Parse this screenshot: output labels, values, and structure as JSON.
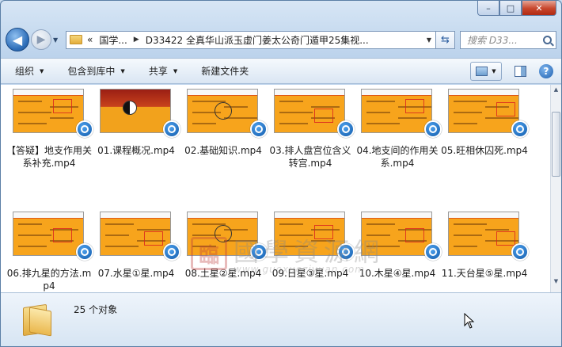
{
  "window": {
    "buttons": {
      "minimize": "–",
      "maximize": "□",
      "close": "✕"
    }
  },
  "nav": {
    "back_icon": "back-arrow-icon",
    "forward_icon": "forward-arrow-icon",
    "breadcrumb_overflow": "«",
    "breadcrumb": [
      "国学...",
      "D33422 全真华山派玉虚门姜太公奇门遁甲25集视..."
    ],
    "search_placeholder": "搜索 D33..."
  },
  "toolbar": {
    "organize": "组织",
    "include_in_library": "包含到库中",
    "share": "共享",
    "new_folder": "新建文件夹",
    "help": "?"
  },
  "files": [
    {
      "name": "【答疑】地支作用关系补充.mp4",
      "thumb": "notes"
    },
    {
      "name": "01.课程概况.mp4",
      "thumb": "course"
    },
    {
      "name": "02.基础知识.mp4",
      "thumb": "diagram"
    },
    {
      "name": "03.排人盘宫位含义转宫.mp4",
      "thumb": "notes"
    },
    {
      "name": "04.地支间的作用关系.mp4",
      "thumb": "notes"
    },
    {
      "name": "05.旺相休囚死.mp4",
      "thumb": "notes"
    },
    {
      "name": "06.排九星的方法.mp4",
      "thumb": "notes"
    },
    {
      "name": "07.水星①星.mp4",
      "thumb": "notes"
    },
    {
      "name": "08.土星②星.mp4",
      "thumb": "diagram"
    },
    {
      "name": "09.日星③星.mp4",
      "thumb": "notes"
    },
    {
      "name": "10.木星④星.mp4",
      "thumb": "notes"
    },
    {
      "name": "11.天台星⑤星.mp4",
      "thumb": "notes"
    }
  ],
  "watermark": {
    "seal": "臨",
    "text": "國學資源網",
    "url": "www.guoxueziyuan.com"
  },
  "details": {
    "item_count": "25 个对象"
  }
}
